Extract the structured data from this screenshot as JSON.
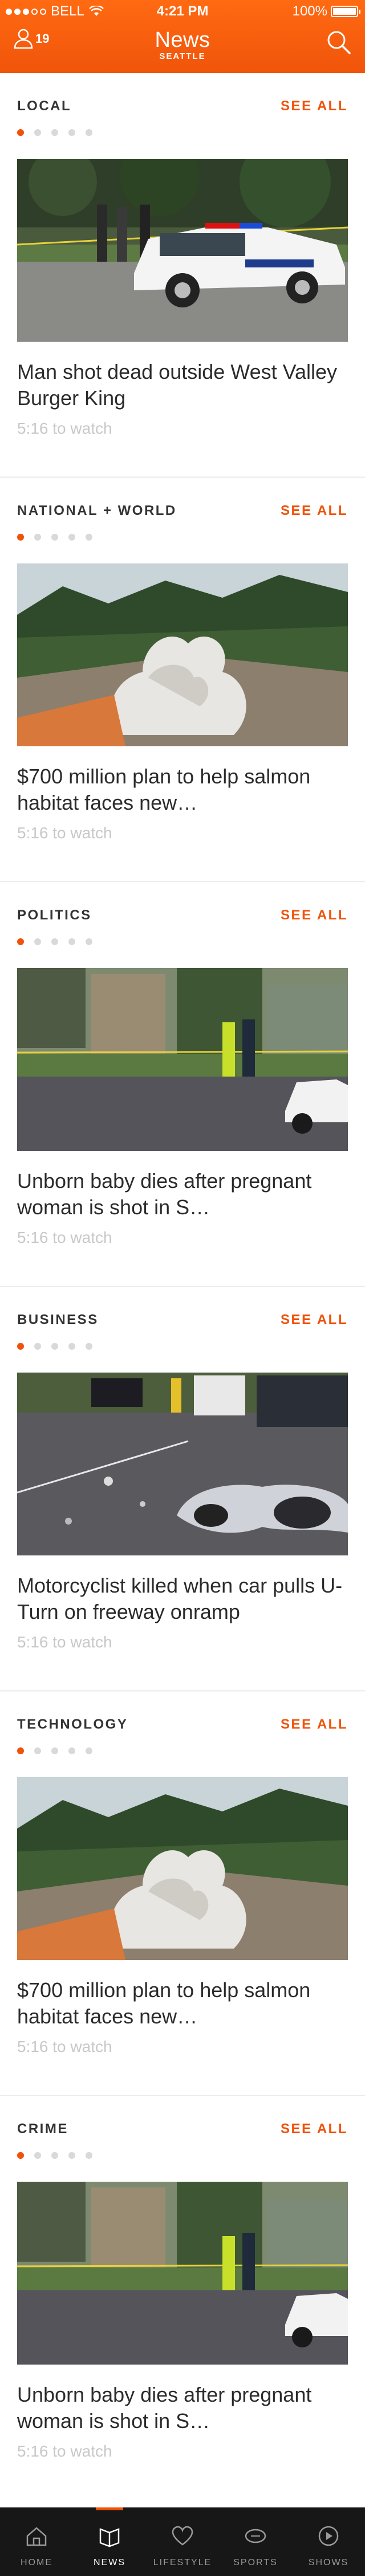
{
  "status_bar": {
    "carrier": "BELL",
    "time": "4:21 PM",
    "battery": "100%",
    "battery_level": 1.0,
    "signal_bars_filled": 3,
    "signal_bars_total": 5
  },
  "header": {
    "title": "News",
    "subtitle": "SEATTLE",
    "user_count": "19",
    "accent_color": "#f0520a"
  },
  "sections": [
    {
      "title": "LOCAL",
      "see_all": "SEE ALL",
      "headline": "Man shot dead outside West Valley Burger King",
      "watch": "5:16 to watch",
      "photo": "police-car-scene"
    },
    {
      "title": "NATIONAL + WORLD",
      "see_all": "SEE ALL",
      "headline": "$700 million plan to help salmon habitat faces new…",
      "watch": "5:16 to watch",
      "photo": "dam-water-explosion"
    },
    {
      "title": "POLITICS",
      "see_all": "SEE ALL",
      "headline": "Unborn baby dies after pregnant woman is shot in S…",
      "watch": "5:16 to watch",
      "photo": "street-crime-scene"
    },
    {
      "title": "BUSINESS",
      "see_all": "SEE ALL",
      "headline": "Motorcyclist killed when car pulls U-Turn on freeway onramp",
      "watch": "5:16 to watch",
      "photo": "motorcycle-crash"
    },
    {
      "title": "TECHNOLOGY",
      "see_all": "SEE ALL",
      "headline": "$700 million plan to help salmon habitat faces new…",
      "watch": "5:16 to watch",
      "photo": "dam-water-explosion"
    },
    {
      "title": "CRIME",
      "see_all": "SEE ALL",
      "headline": "Unborn baby dies after pregnant woman is shot in S…",
      "watch": "5:16 to watch",
      "photo": "street-crime-scene"
    }
  ],
  "tabs": [
    {
      "label": "HOME",
      "icon": "home-icon",
      "active": false
    },
    {
      "label": "NEWS",
      "icon": "news-icon",
      "active": true
    },
    {
      "label": "LIFESTYLE",
      "icon": "heart-icon",
      "active": false
    },
    {
      "label": "SPORTS",
      "icon": "sports-ball-icon",
      "active": false
    },
    {
      "label": "SHOWS",
      "icon": "shows-play-icon",
      "active": false
    }
  ]
}
